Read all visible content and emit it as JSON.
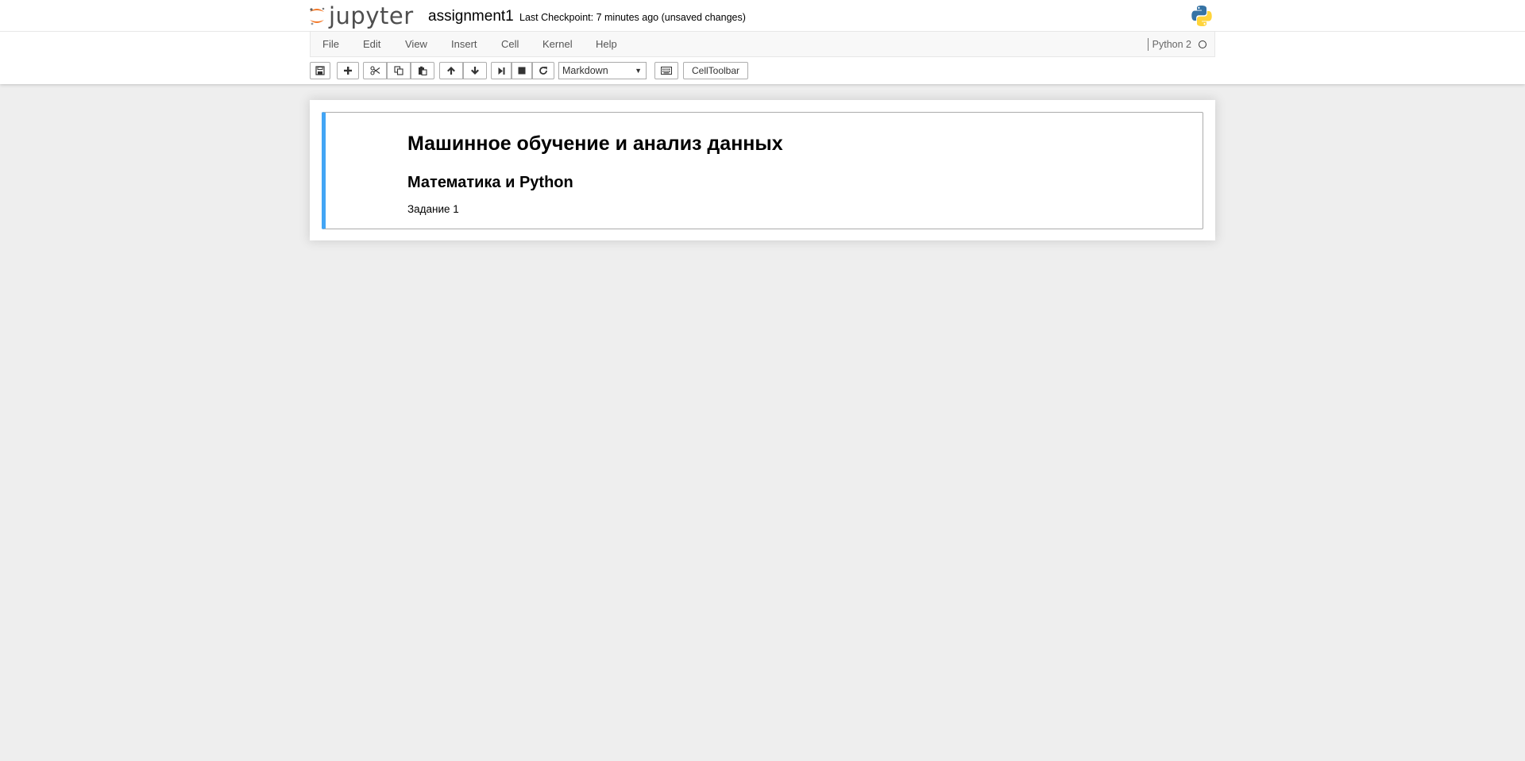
{
  "header": {
    "logo_text": "jupyter",
    "notebook_name": "assignment1",
    "checkpoint_status": "Last Checkpoint: 7 minutes ago (unsaved changes)"
  },
  "menu": {
    "items": [
      "File",
      "Edit",
      "View",
      "Insert",
      "Cell",
      "Kernel",
      "Help"
    ],
    "kernel_name": "Python 2"
  },
  "toolbar": {
    "buttons": [
      "save-icon",
      "plus-icon",
      "scissors-icon",
      "copy-icon",
      "paste-icon",
      "arrow-up-icon",
      "arrow-down-icon",
      "step-forward-icon",
      "stop-icon",
      "refresh-icon",
      "keyboard-icon"
    ],
    "cell_type_selected": "Markdown",
    "celltoolbar_label": "CellToolbar"
  },
  "cell": {
    "heading1": "Машинное обучение и анализ данных",
    "heading2": "Математика и Python",
    "paragraph": "Задание 1"
  },
  "colors": {
    "jupyter_orange": "#f37726",
    "selected_cell_border": "#42a5f5",
    "page_background": "#eeeeee"
  }
}
